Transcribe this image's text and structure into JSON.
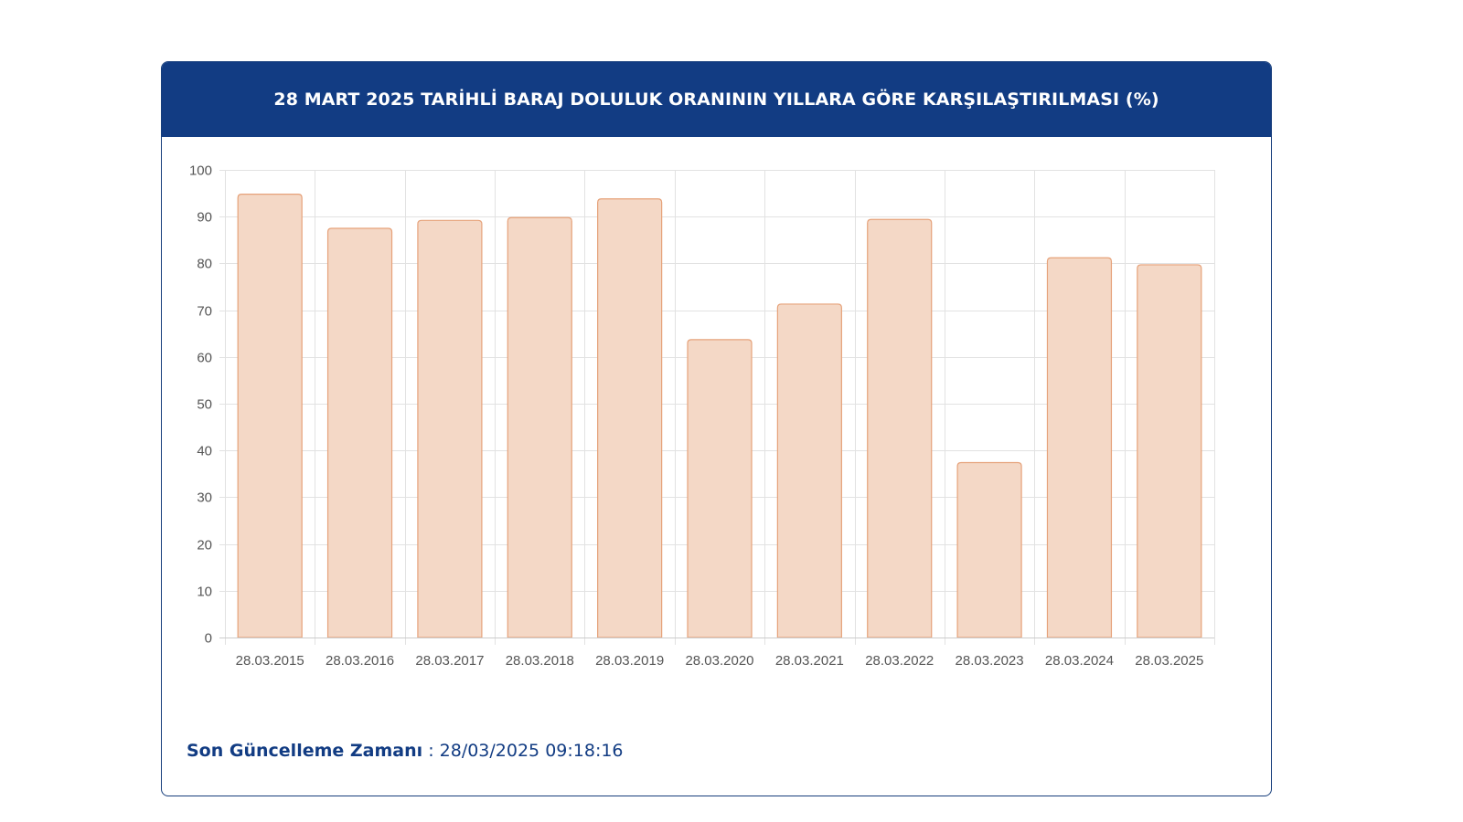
{
  "card": {
    "title": "28 MART 2025 TARİHLİ BARAJ DOLULUK ORANININ YILLARA GÖRE KARŞILAŞTIRILMASI (%)"
  },
  "footer": {
    "update_label": "Son Güncelleme Zamanı",
    "separator": " : ",
    "update_value": "28/03/2025 09:18:16"
  },
  "colors": {
    "header_bg": "#123c83",
    "bar_fill": "#f4d8c6",
    "bar_stroke": "#e6a27a",
    "grid": "#e2e2e2",
    "tick_text": "#555555"
  },
  "chart_data": {
    "type": "bar",
    "title": "28 MART 2025 TARİHLİ BARAJ DOLULUK ORANININ YILLARA GÖRE KARŞILAŞTIRILMASI (%)",
    "xlabel": "",
    "ylabel": "",
    "ylim": [
      0,
      100
    ],
    "y_ticks": [
      0,
      10,
      20,
      30,
      40,
      50,
      60,
      70,
      80,
      90,
      100
    ],
    "grid": true,
    "legend": "none",
    "categories": [
      "28.03.2015",
      "28.03.2016",
      "28.03.2017",
      "28.03.2018",
      "28.03.2019",
      "28.03.2020",
      "28.03.2021",
      "28.03.2022",
      "28.03.2023",
      "28.03.2024",
      "28.03.2025"
    ],
    "values": [
      94.8,
      87.5,
      89.2,
      89.8,
      93.8,
      63.7,
      71.3,
      89.4,
      37.4,
      81.2,
      79.7
    ]
  }
}
